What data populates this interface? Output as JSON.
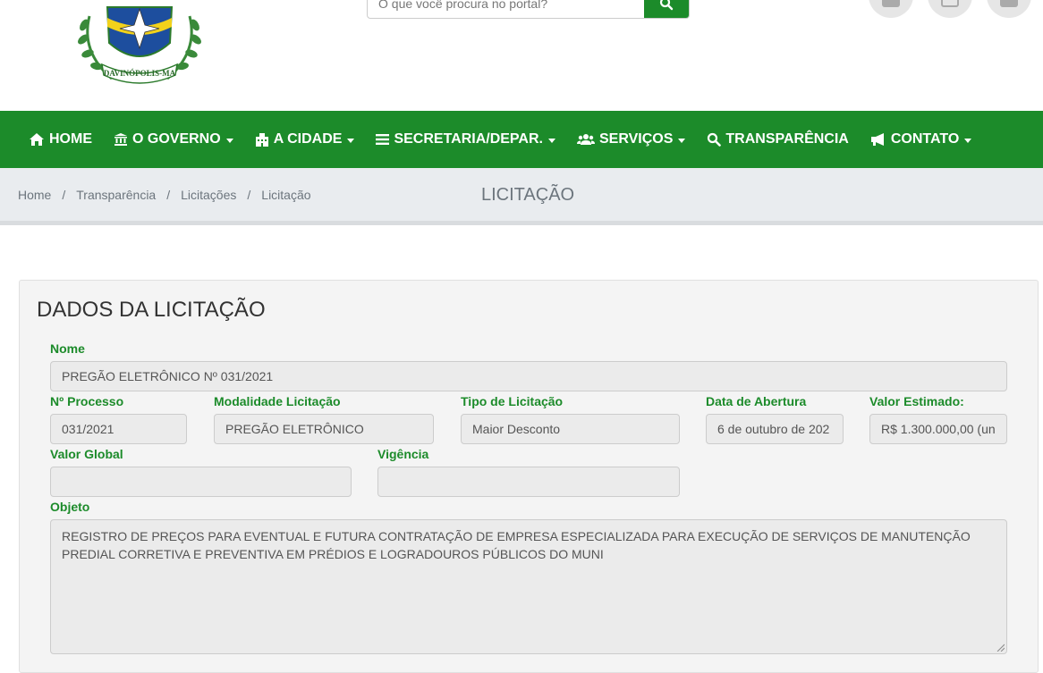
{
  "header": {
    "logo_text": "DAVINÓPOLIS-MA",
    "search_placeholder": "O que você procura no portal?",
    "social": [
      "facebook-icon",
      "instagram-icon",
      "youtube-icon"
    ]
  },
  "nav": {
    "items": [
      {
        "label": "HOME",
        "icon": "home-icon",
        "dropdown": false
      },
      {
        "label": "O GOVERNO",
        "icon": "institution-icon",
        "dropdown": true
      },
      {
        "label": "A CIDADE",
        "icon": "building-icon",
        "dropdown": true
      },
      {
        "label": "SECRETARIA/DEPAR.",
        "icon": "bars-icon",
        "dropdown": true
      },
      {
        "label": "SERVIÇOS",
        "icon": "users-icon",
        "dropdown": true
      },
      {
        "label": "TRANSPARÊNCIA",
        "icon": "search-icon",
        "dropdown": false
      },
      {
        "label": "CONTATO",
        "icon": "bullhorn-icon",
        "dropdown": true
      }
    ]
  },
  "breadcrumb": {
    "items": [
      "Home",
      "Transparência",
      "Licitações",
      "Licitação"
    ],
    "separator": "/",
    "page_title": "LICITAÇÃO"
  },
  "form": {
    "title": "DADOS DA LICITAÇÃO",
    "nome_label": "Nome",
    "nome_value": "PREGÃO ELETRÔNICO Nº 031/2021",
    "processo_label": "Nº Processo",
    "processo_value": "031/2021",
    "modalidade_label": "Modalidade Licitação",
    "modalidade_value": "PREGÃO ELETRÔNICO",
    "tipo_label": "Tipo de Licitação",
    "tipo_value": "Maior Desconto",
    "abertura_label": "Data de Abertura",
    "abertura_value": "6 de outubro de 202",
    "valor_estimado_label": "Valor Estimado:",
    "valor_estimado_value": "R$ 1.300.000,00 (un",
    "valor_global_label": "Valor Global",
    "valor_global_value": "",
    "vigencia_label": "Vigência",
    "vigencia_value": "",
    "objeto_label": "Objeto",
    "objeto_value": "REGISTRO DE PREÇOS PARA EVENTUAL E FUTURA CONTRATAÇÃO DE EMPRESA ESPECIALIZADA PARA EXECUÇÃO DE SERVIÇOS DE MANUTENÇÃO PREDIAL CORRETIVA E PREVENTIVA EM PRÉDIOS E LOGRADOUROS PÚBLICOS DO MUNI"
  },
  "colors": {
    "brand_green": "#1c8b2a",
    "crumb_bg": "#e9ecef",
    "panel_bg": "#f4f4f4",
    "field_bg": "#ebebeb"
  }
}
